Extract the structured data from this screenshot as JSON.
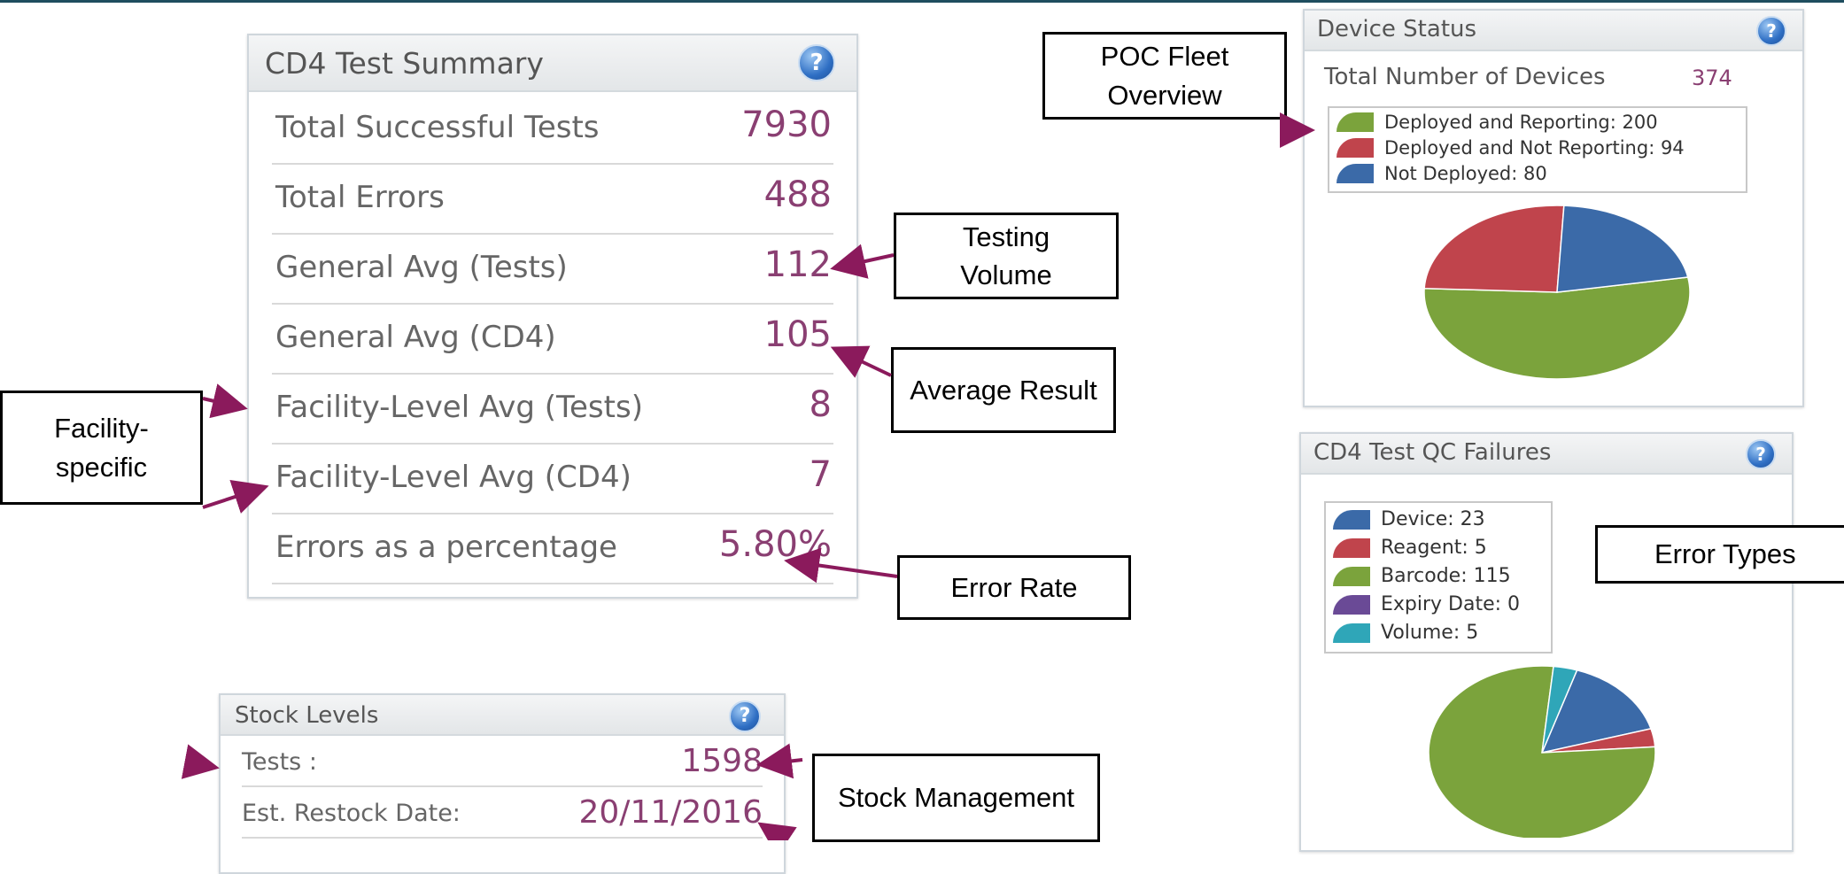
{
  "colors": {
    "value": "#8a3f72",
    "arrow": "#8b1a5c",
    "green": "#7ba33c",
    "red": "#c0444c",
    "blue": "#3b6aa8",
    "purple": "#6a4a96",
    "teal": "#2fa6b8"
  },
  "summary": {
    "title": "CD4 Test Summary",
    "rows": [
      {
        "label": "Total Successful Tests",
        "value": "7930"
      },
      {
        "label": "Total Errors",
        "value": "488"
      },
      {
        "label": "General Avg (Tests)",
        "value": "112"
      },
      {
        "label": "General Avg (CD4)",
        "value": "105"
      },
      {
        "label": "Facility-Level Avg (Tests)",
        "value": "8"
      },
      {
        "label": "Facility-Level Avg (CD4)",
        "value": "7"
      },
      {
        "label": "Errors as a percentage",
        "value": "5.80%"
      }
    ]
  },
  "stock": {
    "title": "Stock Levels",
    "rows": [
      {
        "label": "Tests :",
        "value": "1598"
      },
      {
        "label": "Est. Restock Date:",
        "value": "20/11/2016"
      }
    ]
  },
  "device_status": {
    "title": "Device Status",
    "total_label": "Total Number of Devices",
    "total_value": "374",
    "legend": [
      {
        "label": "Deployed and Reporting: 200",
        "color": "green"
      },
      {
        "label": "Deployed and Not Reporting: 94",
        "color": "red"
      },
      {
        "label": "Not Deployed: 80",
        "color": "blue"
      }
    ],
    "pie_values": [
      200,
      94,
      80
    ]
  },
  "qc_failures": {
    "title": "CD4 Test QC Failures",
    "legend": [
      {
        "label": "Device: 23",
        "color": "blue"
      },
      {
        "label": "Reagent: 5",
        "color": "red"
      },
      {
        "label": "Barcode: 115",
        "color": "green"
      },
      {
        "label": "Expiry Date: 0",
        "color": "purple"
      },
      {
        "label": "Volume: 5",
        "color": "teal"
      }
    ],
    "pie_values": [
      23,
      5,
      115,
      0,
      5
    ]
  },
  "help_icon_text": "?",
  "callouts": {
    "poc_fleet_line1": "POC Fleet",
    "poc_fleet_line2": "Overview",
    "testing_line1": "Testing",
    "testing_line2": "Volume",
    "average_result": "Average Result",
    "facility_line1": "Facility-",
    "facility_line2": "specific",
    "error_rate": "Error Rate",
    "error_types": "Error Types",
    "stock_management": "Stock Management"
  }
}
